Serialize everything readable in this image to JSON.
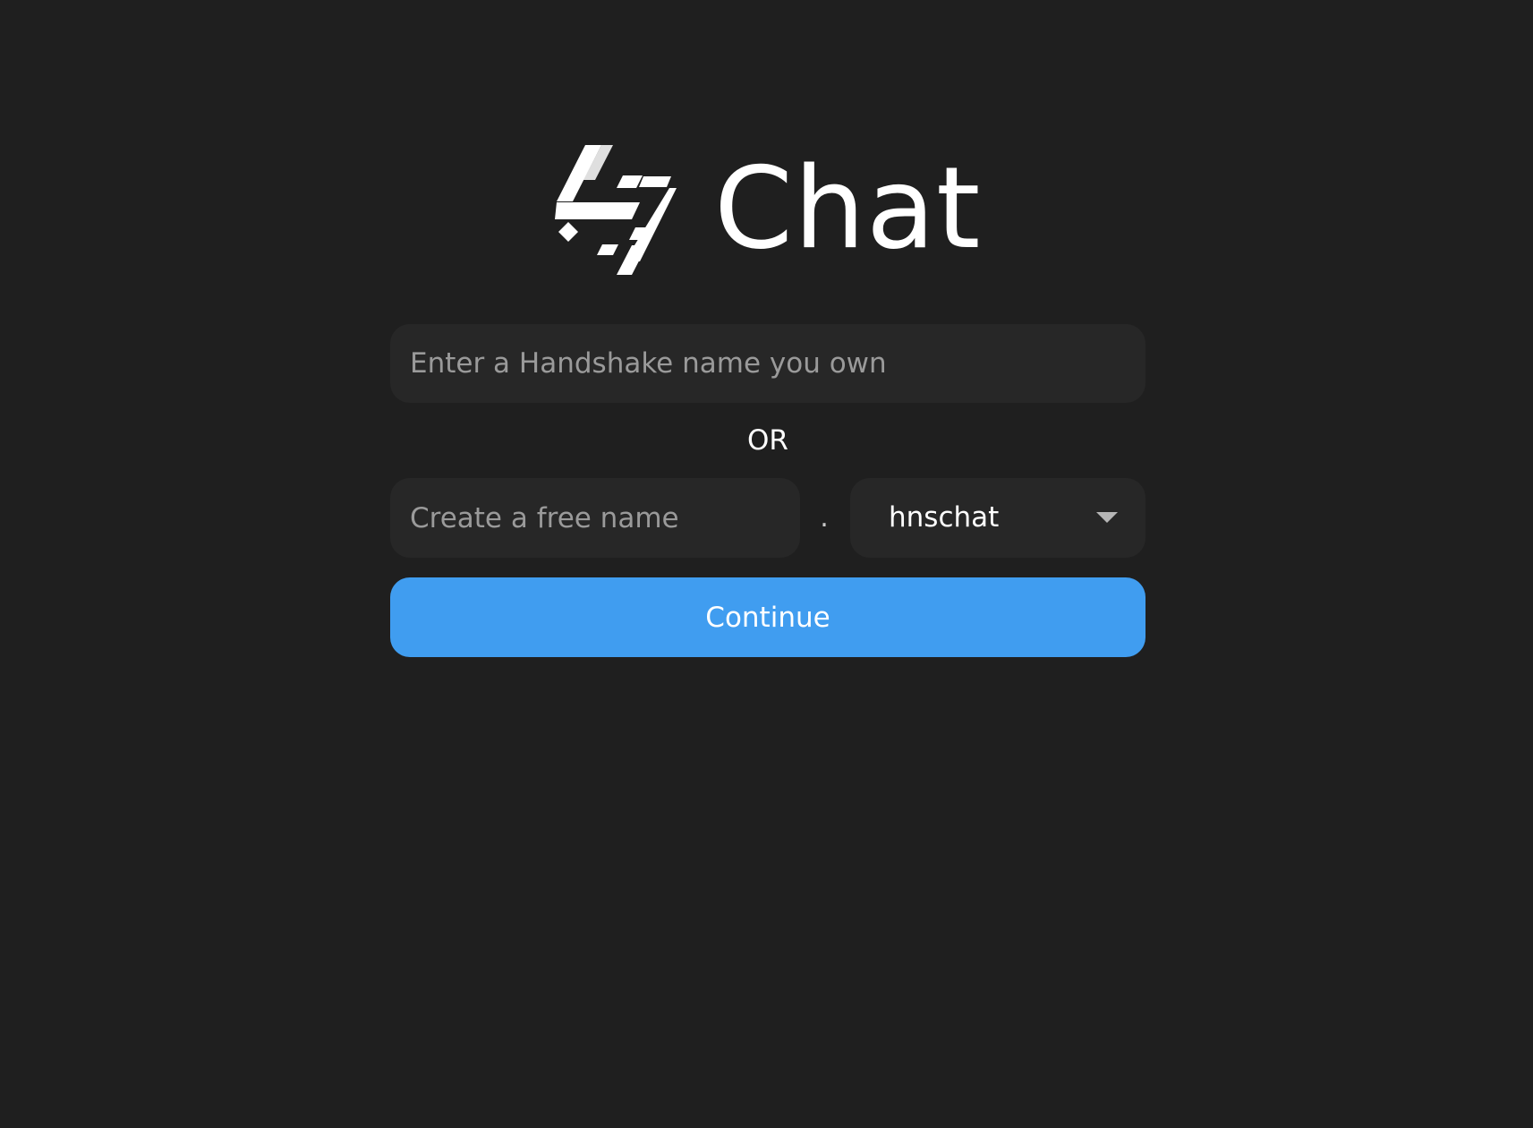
{
  "brand": {
    "title": "Chat",
    "logo_icon": "handshake-logo-icon"
  },
  "login": {
    "owned_name_placeholder": "Enter a Handshake name you own",
    "or_label": "OR",
    "free_name_placeholder": "Create a free name",
    "separator": ".",
    "tld_selected": "hnschat",
    "tld_icon": "chevron-down-icon",
    "continue_label": "Continue"
  },
  "colors": {
    "background": "#1f1f1f",
    "field_background": "#272727",
    "accent": "#409df0",
    "placeholder": "#9a9a9a",
    "text": "#ffffff"
  }
}
